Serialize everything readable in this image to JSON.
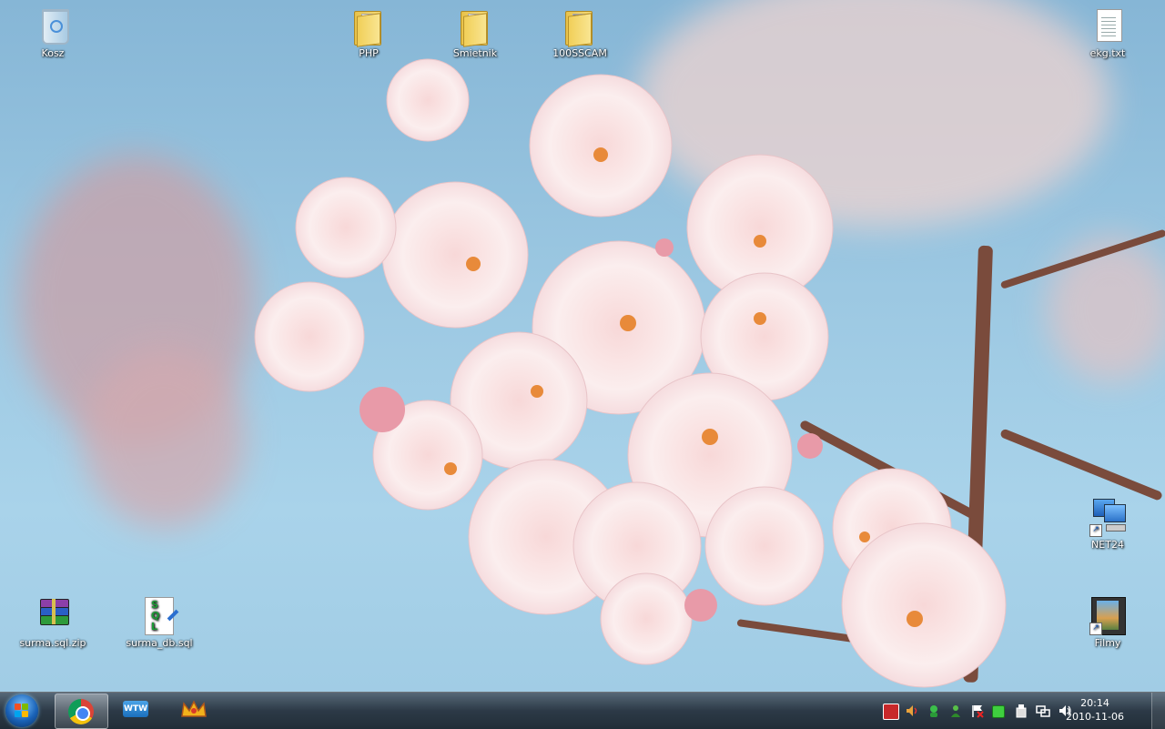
{
  "desktop": {
    "icons": [
      {
        "label": "Kosz",
        "icon": "recycle-bin-icon"
      },
      {
        "label": "PHP",
        "icon": "folder-icon"
      },
      {
        "label": "Smietnik",
        "icon": "folder-icon"
      },
      {
        "label": "100SSCAM",
        "icon": "folder-icon"
      },
      {
        "label": "ekg.txt",
        "icon": "text-file-icon"
      },
      {
        "label": "NET24",
        "icon": "network-shortcut-icon"
      },
      {
        "label": "surma.sql.zip",
        "icon": "winrar-archive-icon"
      },
      {
        "label": "surma_db.sql",
        "icon": "sql-file-icon"
      },
      {
        "label": "Filmy",
        "icon": "film-shortcut-icon"
      }
    ],
    "sql_letters": [
      "S",
      "Q",
      "L"
    ]
  },
  "taskbar": {
    "start": {
      "icon": "windows-start-orb-icon"
    },
    "pinned": [
      {
        "name": "chrome",
        "icon": "chrome-icon",
        "active": true
      },
      {
        "name": "wtw",
        "icon": "wtw-icon",
        "text": "WTW"
      },
      {
        "name": "crown",
        "icon": "crown-app-icon"
      }
    ],
    "tray_icons": [
      "antivirus-icon",
      "volume-alert-icon",
      "green-status-icon",
      "user-green-icon",
      "flag-action-center-icon",
      "green-square-icon",
      "usb-device-icon",
      "network-icon",
      "speaker-icon"
    ],
    "clock": {
      "time": "20:14",
      "date": "2010-11-06"
    }
  },
  "colors": {
    "sky": "#9cc8e2",
    "blossom": "#f7e2e2",
    "blossom_pink": "#e9a3b2",
    "taskbar": "#26323e"
  }
}
